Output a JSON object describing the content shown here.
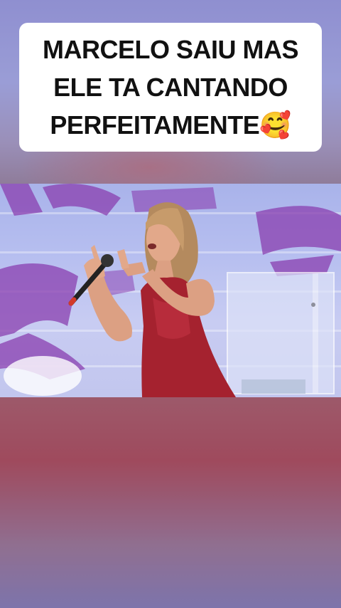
{
  "caption": {
    "line1": "MARCELO SAIU MAS",
    "line2": "ELE TA CANTANDO",
    "line3": "PERFEITAMENTE🥰"
  },
  "colors": {
    "caption_background": "#ffffff",
    "caption_text": "#111111",
    "dress": "#a5222f",
    "stage_backdrop": "#b7bff0",
    "backdrop_letters": "#8a3fb0"
  }
}
